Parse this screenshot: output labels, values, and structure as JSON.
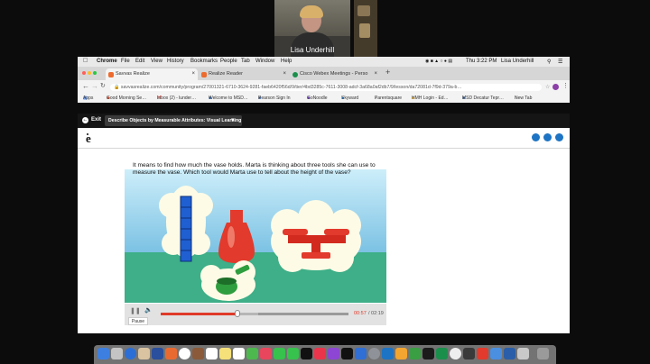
{
  "webcam": {
    "participant_name": "Lisa Underhill"
  },
  "menubar": {
    "apple": "",
    "items": [
      "Chrome",
      "File",
      "Edit",
      "View",
      "History",
      "Bookmarks",
      "People",
      "Tab",
      "Window",
      "Help"
    ],
    "clock": "Thu 3:22 PM",
    "user": "Lisa Underhill"
  },
  "tabs": [
    {
      "label": "Savvas Realize",
      "color": "#ed6b2f",
      "active": true
    },
    {
      "label": "Realize Reader",
      "color": "#ed6b2f",
      "active": false
    },
    {
      "label": "Cisco Webex Meetings - Perso",
      "color": "#1a8f4c",
      "active": false
    }
  ],
  "new_tab": "+",
  "address": {
    "url": "savvasrealize.com/community/program/27001321-6710-3624-9281-faeb6420f56d/9/tier/4bd3285c-7611-3008-adcf-3a68a0af2db7/9/lesson/da72081d-7f9d-379a-b…",
    "bookmarks": [
      "Apps",
      "Good Morning Se…",
      "Inbox (2) - lunder…",
      "Welcome to MSD…",
      "Pearson Sign In",
      "GoNoodle",
      "Skyward",
      "Parentsquare",
      "HMH Login - Ed…",
      "MSD Decatur Tepr…",
      "New Tab"
    ]
  },
  "appbar": {
    "exit": "Exit",
    "lesson_title": "Describe Objects by Measurable Attributes: Visual Learning"
  },
  "lesson": {
    "question": "It means to find how much the vase holds. Marta is thinking about three tools she can use to measure the vase. Which tool would Marta use to tell about the height of the vase?",
    "time_current": "00:57",
    "time_total": "/ 02:19",
    "pause_tooltip": "Pause",
    "progress": 0.41,
    "buffered": 0.52
  },
  "colors": {
    "accent": "#e03a2a",
    "video_sky": "#8fd4f2",
    "ground": "#3eaf88"
  }
}
